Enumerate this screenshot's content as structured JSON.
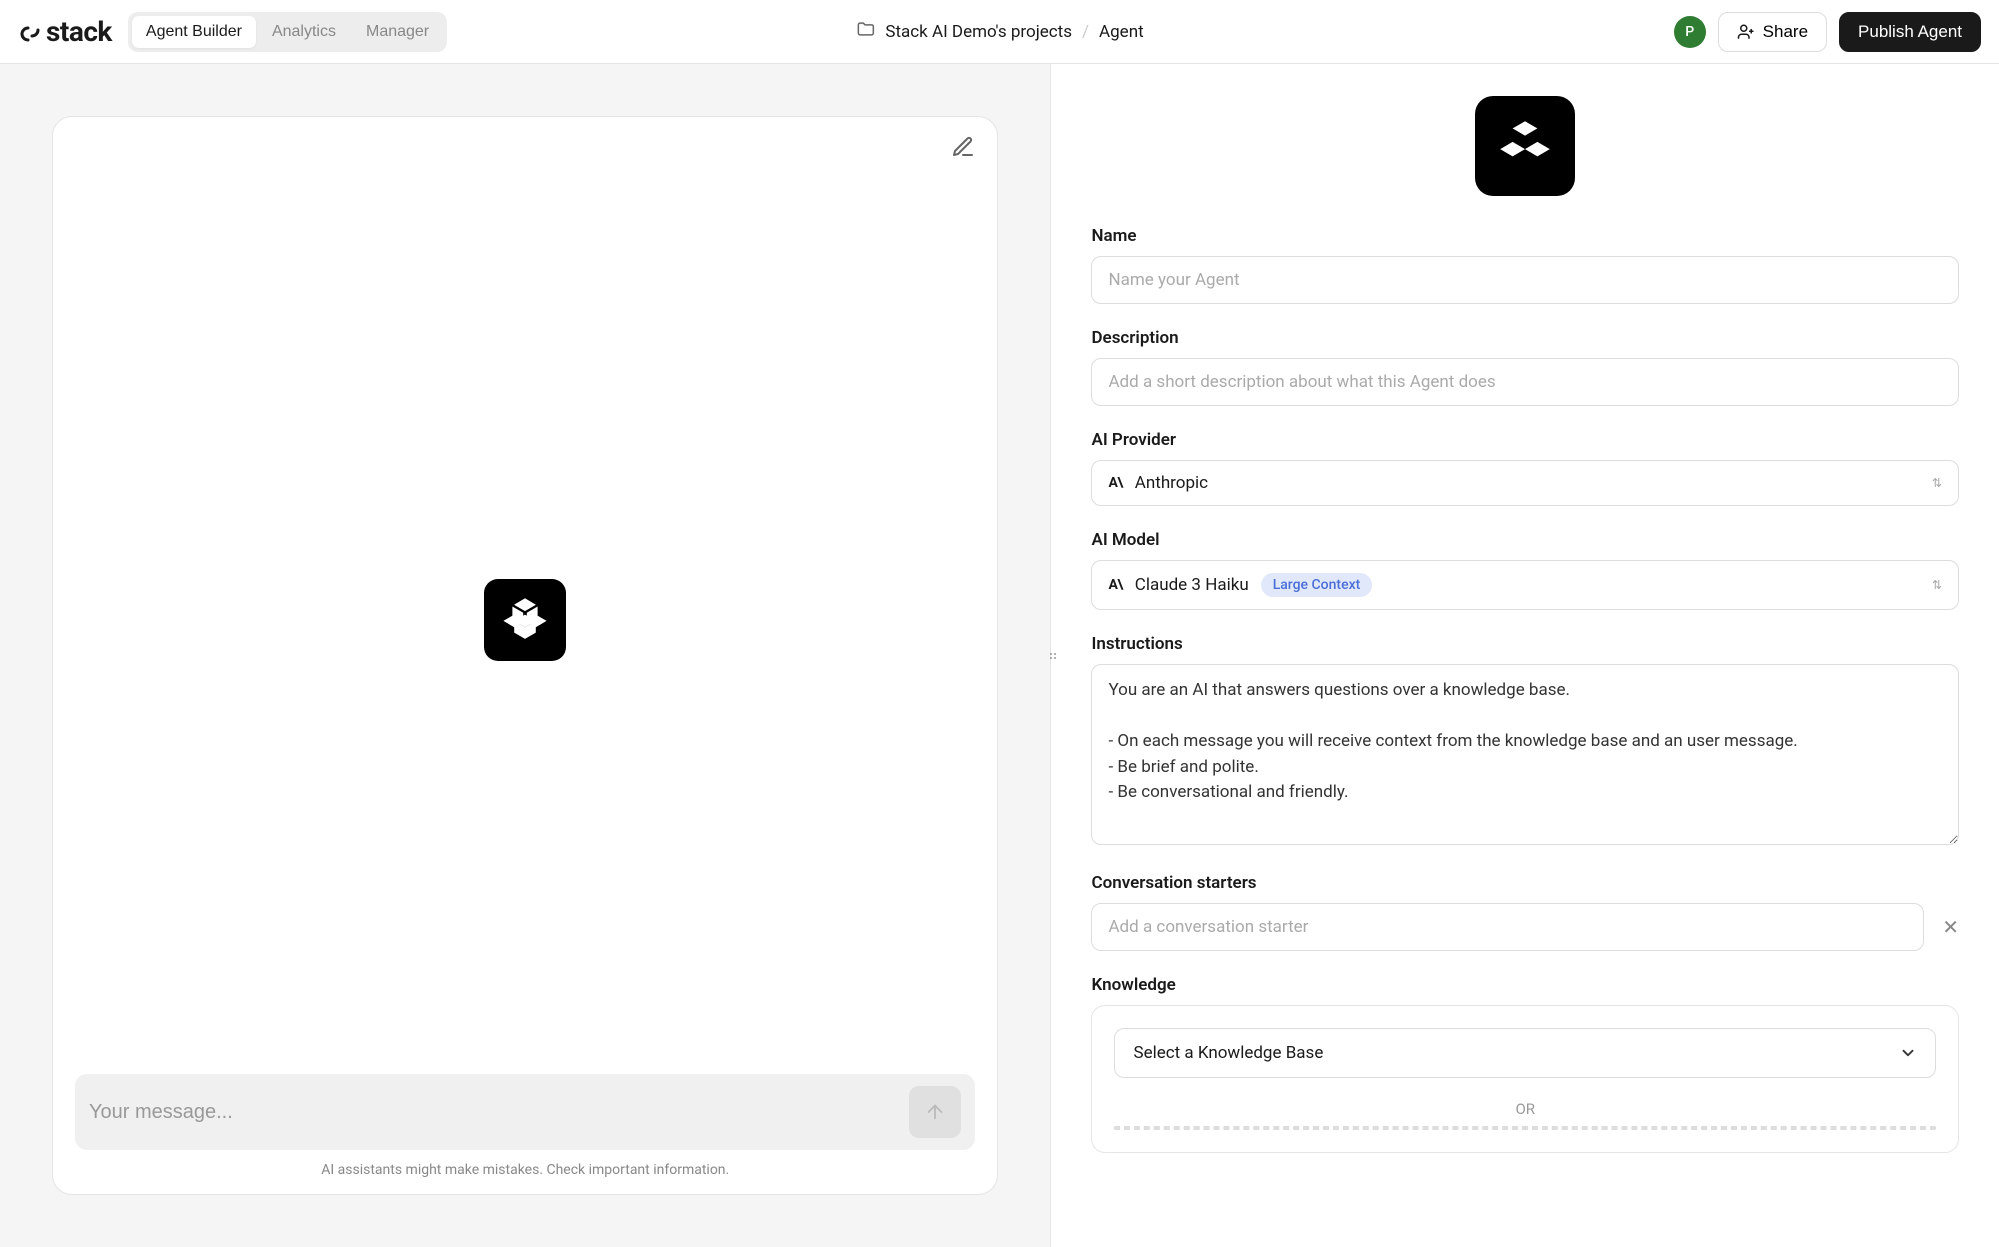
{
  "header": {
    "logo_text": "stack",
    "tabs": [
      "Agent Builder",
      "Analytics",
      "Manager"
    ],
    "active_tab": 0,
    "breadcrumb": {
      "project": "Stack AI Demo's projects",
      "page": "Agent"
    },
    "avatar_initial": "P",
    "share_label": "Share",
    "publish_label": "Publish Agent"
  },
  "chat": {
    "message_placeholder": "Your message...",
    "disclaimer": "AI assistants might make mistakes. Check important information."
  },
  "form": {
    "name": {
      "label": "Name",
      "placeholder": "Name your Agent",
      "value": ""
    },
    "description": {
      "label": "Description",
      "placeholder": "Add a short description about what this Agent does",
      "value": ""
    },
    "provider": {
      "label": "AI Provider",
      "value": "Anthropic"
    },
    "model": {
      "label": "AI Model",
      "value": "Claude 3 Haiku",
      "badge": "Large Context"
    },
    "instructions": {
      "label": "Instructions",
      "value": "You are an AI that answers questions over a knowledge base.\n\n- On each message you will receive context from the knowledge base and an user message.\n- Be brief and polite.\n- Be conversational and friendly."
    },
    "starters": {
      "label": "Conversation starters",
      "placeholder": "Add a conversation starter"
    },
    "knowledge": {
      "label": "Knowledge",
      "select_placeholder": "Select a Knowledge Base",
      "or_text": "OR"
    }
  }
}
